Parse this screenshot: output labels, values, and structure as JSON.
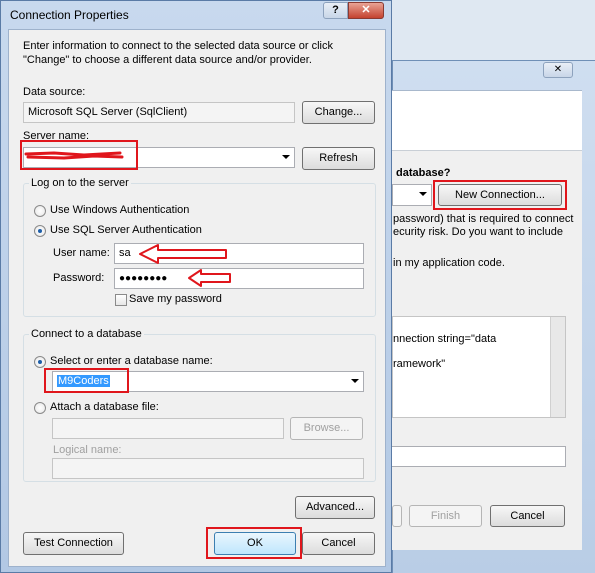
{
  "dialog": {
    "title": "Connection Properties",
    "intro": "Enter information to connect to the selected data source or click \"Change\" to choose a different data source and/or provider.",
    "data_source_label": "Data source:",
    "data_source_value": "Microsoft SQL Server (SqlClient)",
    "change_button": "Change...",
    "server_name_label": "Server name:",
    "server_name_value": "",
    "refresh_button": "Refresh",
    "logon_group": "Log on to the server",
    "windows_auth": "Use Windows Authentication",
    "sql_auth": "Use SQL Server Authentication",
    "sql_auth_selected": true,
    "username_label": "User name:",
    "username_value": "sa",
    "password_label": "Password:",
    "password_value": "●●●●●●●●",
    "save_password": "Save my password",
    "save_password_checked": false,
    "db_group": "Connect to a database",
    "select_db": "Select or enter a database name:",
    "db_value": "M9Coders",
    "attach_db": "Attach a database file:",
    "browse_button": "Browse...",
    "logical_name_label": "Logical name:",
    "advanced_button": "Advanced...",
    "test_button": "Test Connection",
    "ok_button": "OK",
    "cancel_button": "Cancel",
    "help_glyph": "?",
    "close_glyph": "✕"
  },
  "background_wizard": {
    "close_glyph": "✕",
    "question_partial": "database?",
    "new_connection_button": "New Connection...",
    "text_line1": "password) that is required to connect",
    "text_line2": "ecurity risk. Do you want to include",
    "text_line3": "in my application code.",
    "conn_string_line1": "nnection string=\"data",
    "conn_string_line2": "ramework\"",
    "finish_button": "Finish",
    "cancel_button": "Cancel"
  },
  "colors": {
    "annotation_red": "#e0161c",
    "selection_blue": "#3399ff",
    "title_bar": "#c8d9ee"
  }
}
